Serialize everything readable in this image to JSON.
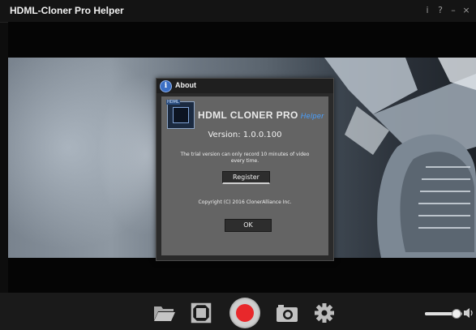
{
  "window": {
    "title": "HDML-Cloner Pro Helper",
    "controls": [
      "i",
      "?",
      "–",
      "×"
    ]
  },
  "about_dialog": {
    "title": "About",
    "product_name": "HDML CLONER PRO",
    "product_suffix": "Helper",
    "logo_badge": "HDML",
    "version": "Version: 1.0.0.100",
    "trial_notice": "The trial version can only record 10 minutes of video every time.",
    "register_label": "Register",
    "copyright": "Copyright (C) 2016 ClonerAlliance Inc.",
    "ok_label": "OK"
  },
  "toolbar": {
    "icons": [
      "folder-icon",
      "fullscreen-icon",
      "record-button",
      "camera-icon",
      "gear-icon"
    ],
    "record_color": "#e8282b",
    "volume_level": 0.85
  },
  "colors": {
    "title_bar": "#141414",
    "dialog_body": "#646464",
    "accent_blue": "#4aa0ff"
  }
}
